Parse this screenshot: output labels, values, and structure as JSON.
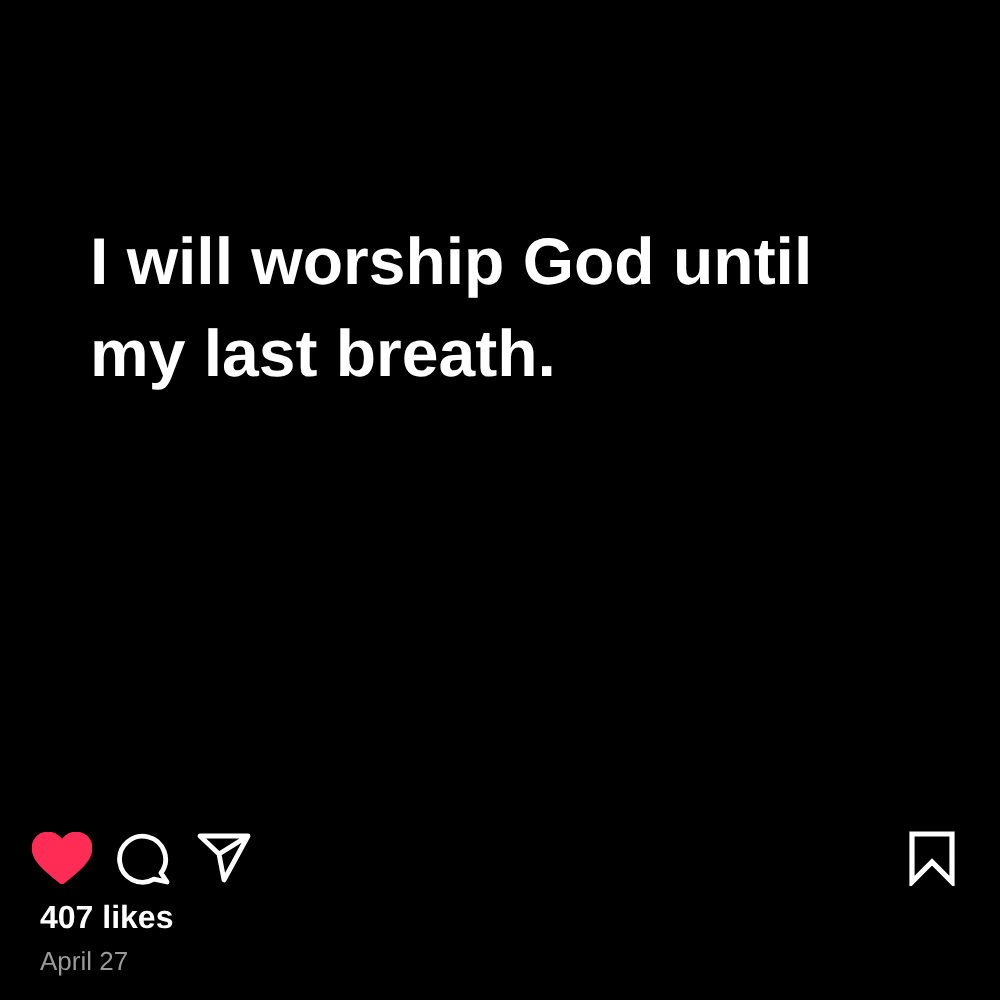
{
  "post": {
    "text": "I will worship God until my last breath."
  },
  "actions": {
    "liked": true,
    "saved": false
  },
  "likes": "407 likes",
  "date": "April 27"
}
